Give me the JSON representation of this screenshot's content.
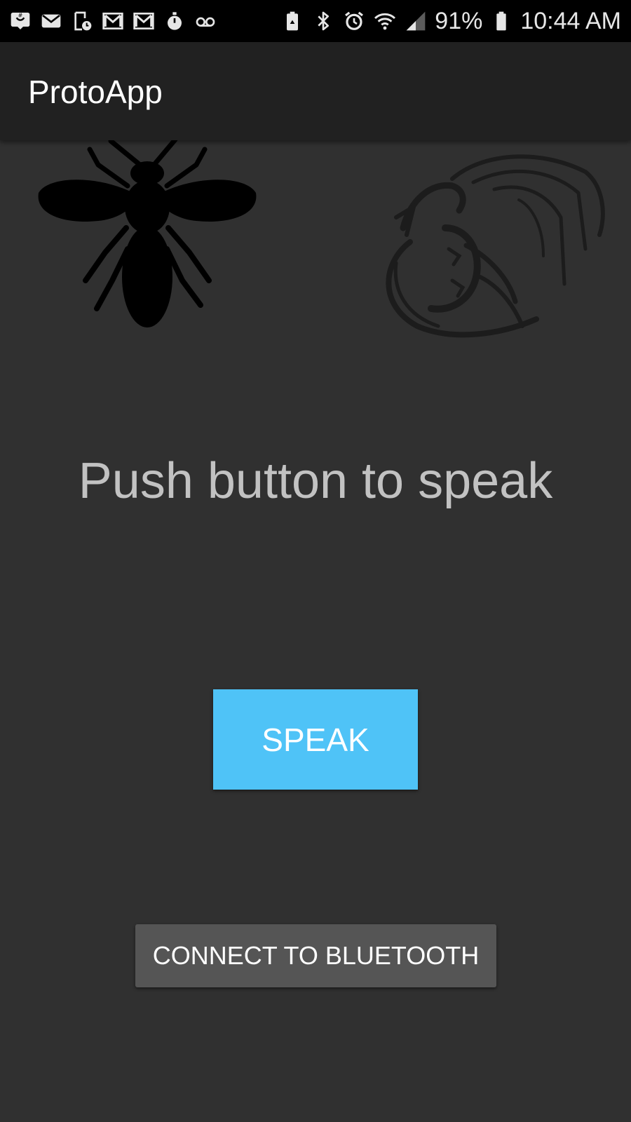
{
  "status_bar": {
    "left_icons": [
      "messaging-icon",
      "email-icon",
      "calendar-reminder-icon",
      "gmail-icon",
      "gmail-icon",
      "stopwatch-icon",
      "voicemail-icon"
    ],
    "right_icons": [
      "battery-saver-icon",
      "bluetooth-icon",
      "alarm-icon",
      "wifi-icon",
      "signal-icon",
      "battery-icon"
    ],
    "battery_percent": "91%",
    "time": "10:44 AM"
  },
  "app_bar": {
    "title": "ProtoApp"
  },
  "main": {
    "images": [
      "bee-icon",
      "dragon-icon"
    ],
    "prompt": "Push button to speak",
    "speak_label": "SPEAK",
    "bluetooth_label": "CONNECT TO BLUETOOTH"
  },
  "colors": {
    "background": "#303030",
    "status_bar": "#000000",
    "app_bar": "#212121",
    "speak_button": "#4fc3f7",
    "bluetooth_button": "#555555",
    "prompt_text": "#c2c2c2"
  }
}
